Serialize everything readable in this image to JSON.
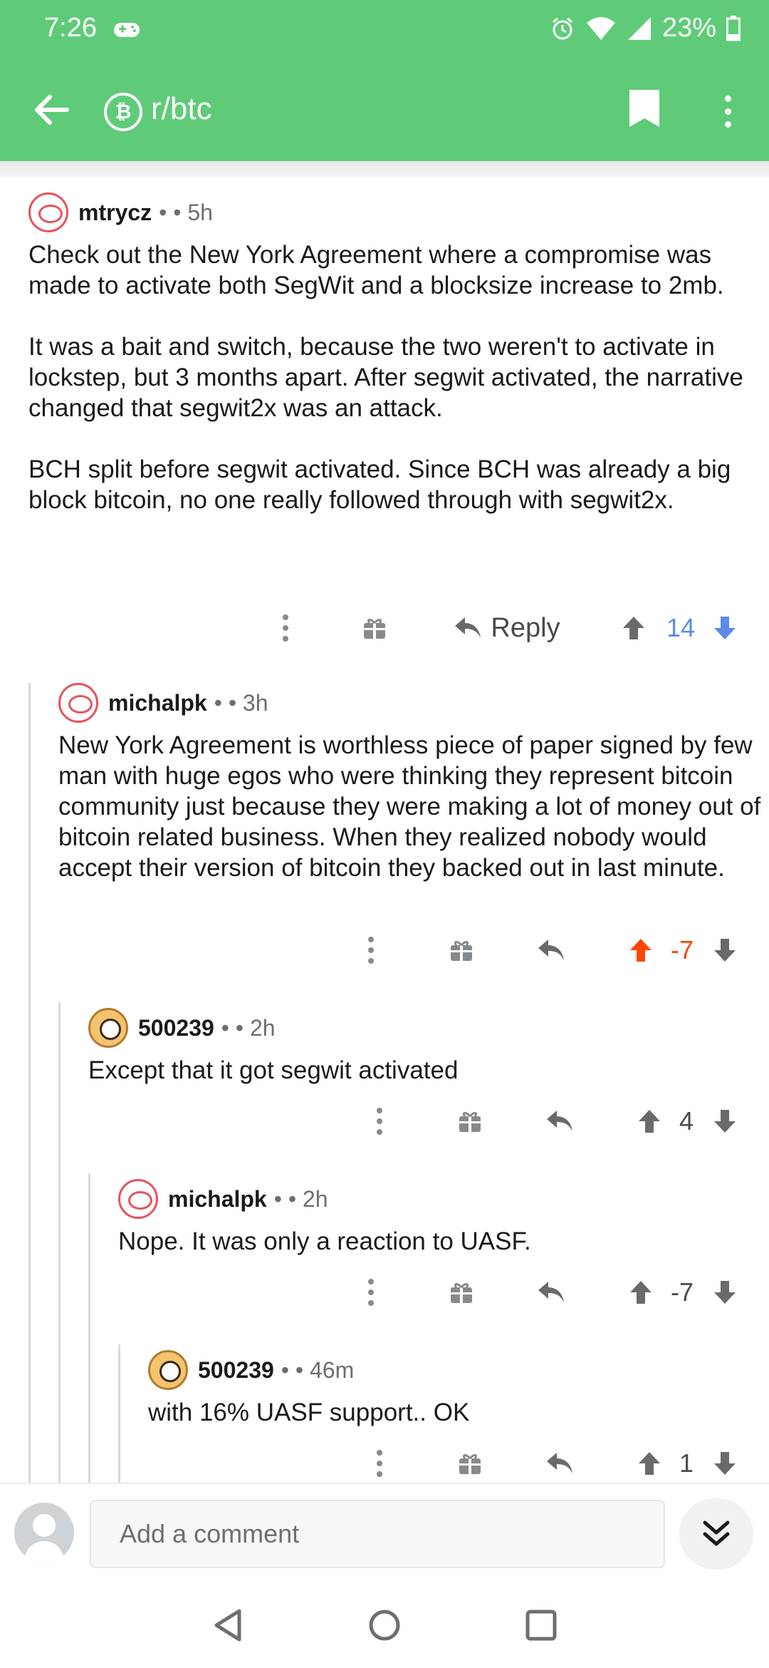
{
  "status_bar": {
    "time": "7:26",
    "battery": "23%"
  },
  "app_bar": {
    "subreddit": "r/btc",
    "subreddit_icon_glyph": "₿"
  },
  "comments": [
    {
      "author": "mtrycz",
      "meta": "• • 5h",
      "avatar": "red",
      "paragraphs": [
        "Check out the New York Agreement where a compromise was made to activate both SegWit and a blocksize increase to 2mb.",
        "It was a bait and switch, because the two weren't to activate in lockstep, but 3 months apart. After segwit activated, the narrative changed that segwit2x was an attack.",
        "BCH split before segwit activated. Since BCH was already a big block bitcoin, no one really followed through with segwit2x."
      ],
      "reply_label": "Reply",
      "score": "14",
      "vote_state": "downvoted"
    },
    {
      "author": "michalpk",
      "meta": "• • 3h",
      "avatar": "red",
      "paragraphs": [
        "New York Agreement is worthless piece of paper signed by few man with huge egos who were thinking they represent bitcoin community just because they were making a lot of money out of bitcoin related business. When they realized nobody would accept their version of bitcoin they backed out in last minute."
      ],
      "score": "-7",
      "vote_state": "upvoted"
    },
    {
      "author": "500239",
      "meta": "• • 2h",
      "avatar": "dog",
      "paragraphs": [
        "Except that it got segwit activated"
      ],
      "score": "4",
      "vote_state": "none"
    },
    {
      "author": "michalpk",
      "meta": "• • 2h",
      "avatar": "red",
      "paragraphs": [
        "Nope. It was only a reaction to UASF."
      ],
      "score": "-7",
      "vote_state": "none"
    },
    {
      "author": "500239",
      "meta": "• • 46m",
      "avatar": "dog",
      "paragraphs": [
        "with 16% UASF support.. OK"
      ],
      "score": "1",
      "vote_state": "none"
    }
  ],
  "composer": {
    "placeholder": "Add a comment"
  },
  "colors": {
    "app_bar": "#5fcb78",
    "upvote": "#ff4500",
    "downvote": "#5a8be8",
    "neutral": "#4a4a4a"
  }
}
